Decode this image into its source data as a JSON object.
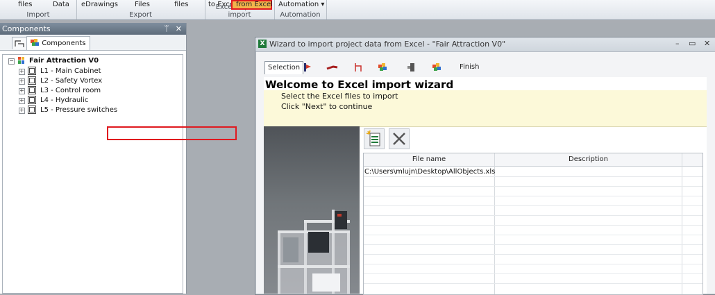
{
  "ribbon": {
    "groups": [
      {
        "label": "Import",
        "buttons": [
          "files",
          "Data"
        ]
      },
      {
        "label": "Export",
        "buttons": [
          "eDrawings",
          "Files",
          "files"
        ]
      },
      {
        "label": "Excel export / import",
        "buttons": [
          "to Excel",
          "from Excel"
        ]
      },
      {
        "label": "Automation",
        "buttons": [
          "Automation ▾"
        ]
      }
    ]
  },
  "panel": {
    "title": "Components",
    "pin_glyph": "ᛠ",
    "close_glyph": "✕",
    "tab_label": "Components",
    "tree": {
      "root": "Fair Attraction V0",
      "children": [
        "L1 - Main Cabinet",
        "L2 - Safety Vortex",
        "L3 - Control room",
        "L4 - Hydraulic",
        "L5 - Pressure switches"
      ]
    }
  },
  "wizard": {
    "title": "Wizard to import project data from Excel - \"Fair Attraction V0\"",
    "tabs": {
      "selection": "Selection",
      "finish": "Finish"
    },
    "heading": "Welcome to Excel import wizard",
    "instruction_1": "Select the Excel files to import",
    "instruction_2": "Click \"Next\" to continue",
    "table": {
      "columns": [
        "File name",
        "Description"
      ],
      "rows": [
        {
          "file": "C:\\Users\\mlujn\\Desktop\\AllObjects.xls",
          "description": ""
        }
      ]
    }
  },
  "colors": {
    "highlight": "#e0191f",
    "band": "#fcf9d9"
  }
}
